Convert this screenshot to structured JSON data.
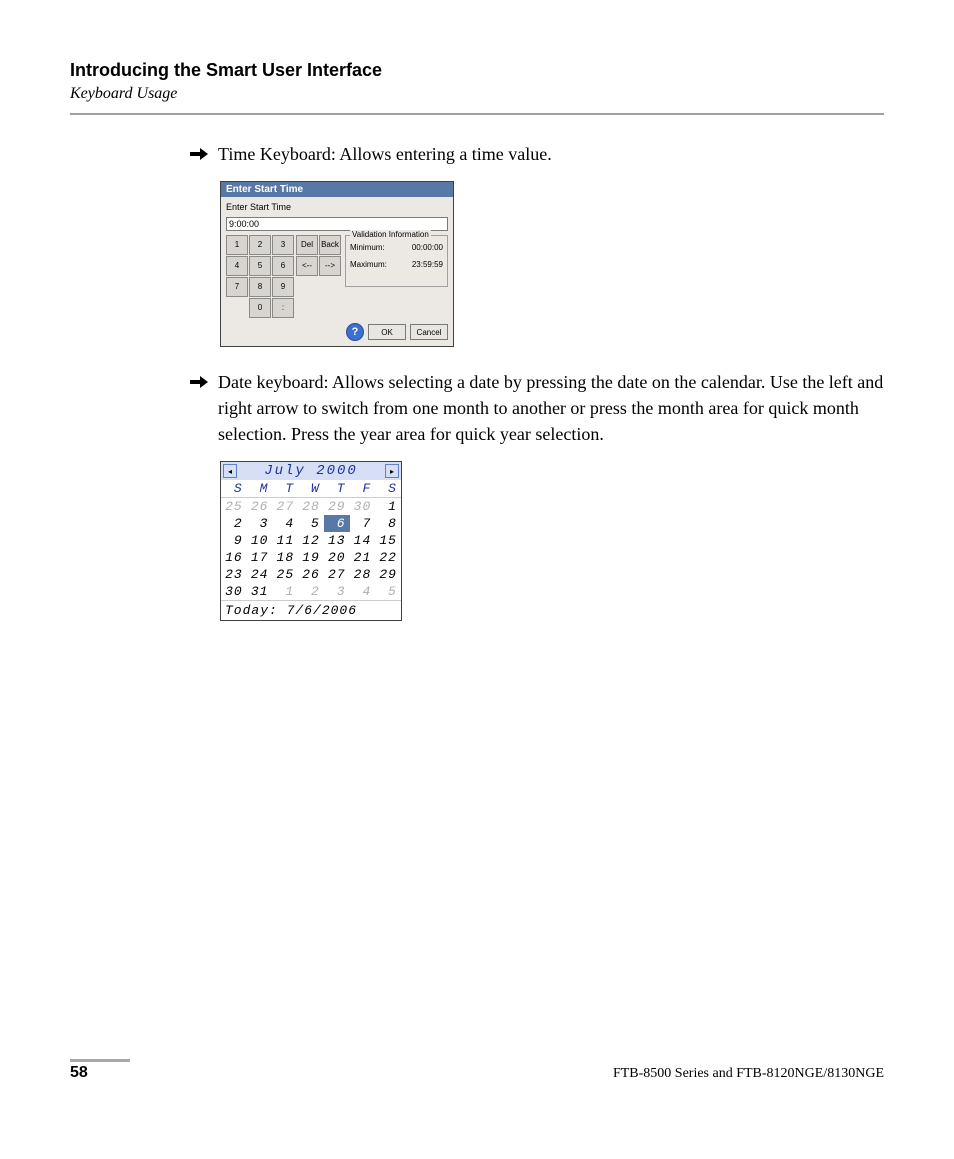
{
  "header": {
    "chapter_title": "Introducing the Smart User Interface",
    "section_sub": "Keyboard Usage"
  },
  "paragraphs": {
    "time_intro": "Time Keyboard: Allows entering a time value.",
    "date_intro": "Date keyboard: Allows selecting a date by pressing the date on the calendar. Use the left and right arrow to switch from one month to another or press the month area for quick month selection. Press the year area for quick year selection."
  },
  "time_dialog": {
    "titlebar": "Enter Start Time",
    "inner_label": "Enter Start Time",
    "input_value": "9:00:00",
    "keys": {
      "1": "1",
      "2": "2",
      "3": "3",
      "4": "4",
      "5": "5",
      "6": "6",
      "7": "7",
      "8": "8",
      "9": "9",
      "0": "0",
      "colon": ":"
    },
    "edit": {
      "del": "Del",
      "back": "Back",
      "left": "<--",
      "right": "-->"
    },
    "validation": {
      "legend": "Validation Information",
      "min_label": "Minimum:",
      "min_value": "00:00:00",
      "max_label": "Maximum:",
      "max_value": "23:59:59"
    },
    "buttons": {
      "help": "?",
      "ok": "OK",
      "cancel": "Cancel"
    }
  },
  "calendar": {
    "nav_prev": "◂",
    "nav_next": "▸",
    "month_year": "July 2000",
    "dow": {
      "sun": "S",
      "mon": "M",
      "tue": "T",
      "wed": "W",
      "thu": "T",
      "fri": "F",
      "sat": "S"
    },
    "cells": [
      {
        "v": "25",
        "other": true
      },
      {
        "v": "26",
        "other": true
      },
      {
        "v": "27",
        "other": true
      },
      {
        "v": "28",
        "other": true
      },
      {
        "v": "29",
        "other": true
      },
      {
        "v": "30",
        "other": true
      },
      {
        "v": "1"
      },
      {
        "v": "2"
      },
      {
        "v": "3"
      },
      {
        "v": "4"
      },
      {
        "v": "5"
      },
      {
        "v": "6",
        "selected": true
      },
      {
        "v": "7"
      },
      {
        "v": "8"
      },
      {
        "v": "9"
      },
      {
        "v": "10"
      },
      {
        "v": "11"
      },
      {
        "v": "12"
      },
      {
        "v": "13"
      },
      {
        "v": "14"
      },
      {
        "v": "15"
      },
      {
        "v": "16"
      },
      {
        "v": "17"
      },
      {
        "v": "18"
      },
      {
        "v": "19"
      },
      {
        "v": "20"
      },
      {
        "v": "21"
      },
      {
        "v": "22"
      },
      {
        "v": "23"
      },
      {
        "v": "24"
      },
      {
        "v": "25"
      },
      {
        "v": "26"
      },
      {
        "v": "27"
      },
      {
        "v": "28"
      },
      {
        "v": "29"
      },
      {
        "v": "30"
      },
      {
        "v": "31"
      },
      {
        "v": "1",
        "other": true
      },
      {
        "v": "2",
        "other": true
      },
      {
        "v": "3",
        "other": true
      },
      {
        "v": "4",
        "other": true
      },
      {
        "v": "5",
        "other": true
      }
    ],
    "today_label": "Today: 7/6/2006"
  },
  "footer": {
    "page_number": "58",
    "product_line": "FTB-8500 Series and FTB-8120NGE/8130NGE"
  }
}
